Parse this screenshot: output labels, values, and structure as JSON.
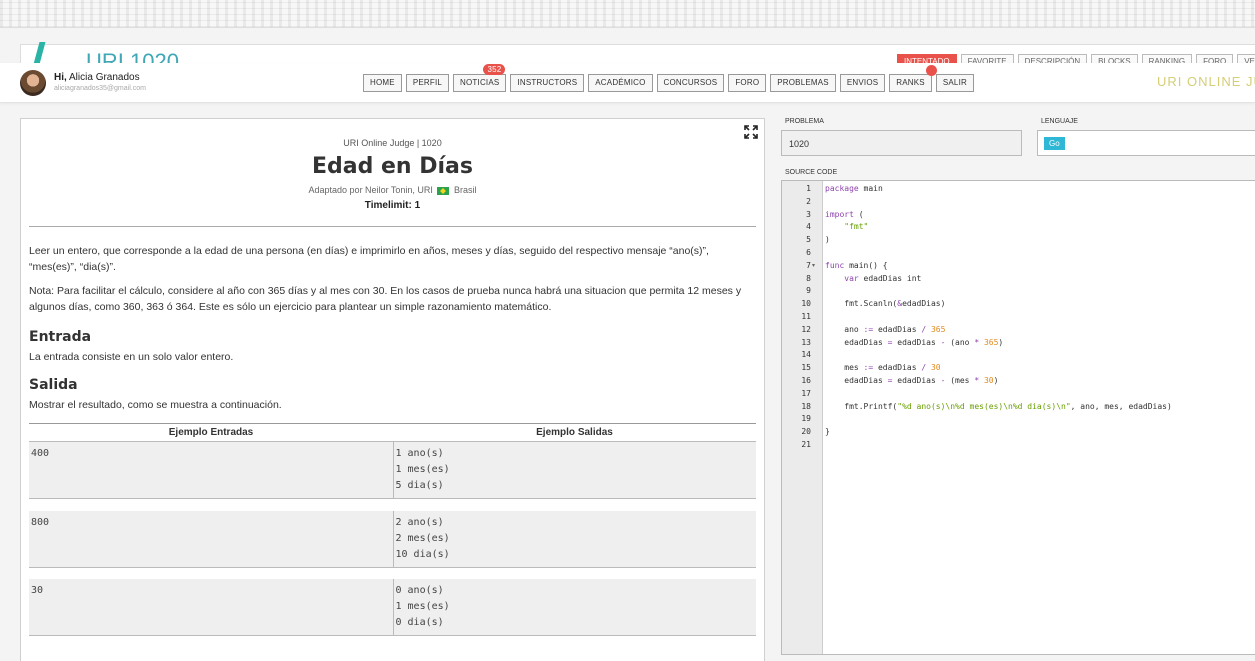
{
  "background_app": {
    "title": "URI 1020",
    "tabs": [
      "INTENTADO",
      "FAVORITE",
      "DESCRIPCIÓN",
      "BLOCKS",
      "RANKING",
      "FORO",
      "VERDI"
    ]
  },
  "header": {
    "greeting": "Hi,",
    "user_name": "Alicia Granados",
    "user_email": "aliciagranados35@gmail.com",
    "nav": [
      {
        "label": "HOME"
      },
      {
        "label": "PERFIL"
      },
      {
        "label": "NOTICIAS",
        "badge": "352"
      },
      {
        "label": "INSTRUCTORS"
      },
      {
        "label": "ACADÉMICO"
      },
      {
        "label": "CONCURSOS"
      },
      {
        "label": "FORO"
      },
      {
        "label": "PROBLEMAS"
      },
      {
        "label": "ENVIOS"
      },
      {
        "label": "RANKS",
        "dot": true
      },
      {
        "label": "SALIR"
      }
    ],
    "brand": "URI ONLINE JU"
  },
  "problem": {
    "meta": "URI Online Judge | 1020",
    "title": "Edad en Días",
    "author_prefix": "Adaptado por Neilor Tonin, URI",
    "author_country": "Brasil",
    "timelimit": "Timelimit: 1",
    "description": [
      "Leer un entero, que corresponde a la edad de una persona (en días) e imprimirlo en años, meses y días, seguido del respectivo mensaje “ano(s)”, “mes(es)”, “dia(s)”.",
      "Nota: Para facilitar el cálculo, considere al año con 365 días y al mes con 30. En los casos de prueba nunca habrá una situacion que permita 12 meses y algunos días, como 360, 363 ó 364. Este es sólo un ejercicio para plantear un simple razonamiento matemático."
    ],
    "input_heading": "Entrada",
    "input_text": "La entrada consiste en un solo valor entero.",
    "output_heading": "Salida",
    "output_text": "Mostrar el resultado, como se muestra a continuación.",
    "examples_header_in": "Ejemplo Entradas",
    "examples_header_out": "Ejemplo Salidas",
    "examples": [
      {
        "input": "400",
        "output": "1 ano(s)\n1 mes(es)\n5 dia(s)"
      },
      {
        "input": "800",
        "output": "2 ano(s)\n2 mes(es)\n10 dia(s)"
      },
      {
        "input": "30",
        "output": "0 ano(s)\n1 mes(es)\n0 dia(s)"
      }
    ]
  },
  "editor_panel": {
    "problem_label": "PROBLEMA",
    "problem_value": "1020",
    "language_label": "LENGUAJE",
    "language_value": "Go",
    "source_label": "SOURCE CODE"
  },
  "code_lines": [
    "package main",
    "",
    "import (",
    "    \"fmt\"",
    ")",
    "",
    "func main() {",
    "    var edadDias int",
    "",
    "    fmt.Scanln(&edadDias)",
    "",
    "    ano := edadDias / 365",
    "    edadDias = edadDias - (ano * 365)",
    "",
    "    mes := edadDias / 30",
    "    edadDias = edadDias - (mes * 30)",
    "",
    "    fmt.Printf(\"%d ano(s)\\n%d mes(es)\\n%d dia(s)\\n\", ano, mes, edadDias)",
    "",
    "}",
    ""
  ],
  "colors": {
    "badge": "#e9524a",
    "lang_chip": "#2fb7d6",
    "keyword": "#8e44ad",
    "string": "#689f00",
    "number": "#e08a1e"
  }
}
